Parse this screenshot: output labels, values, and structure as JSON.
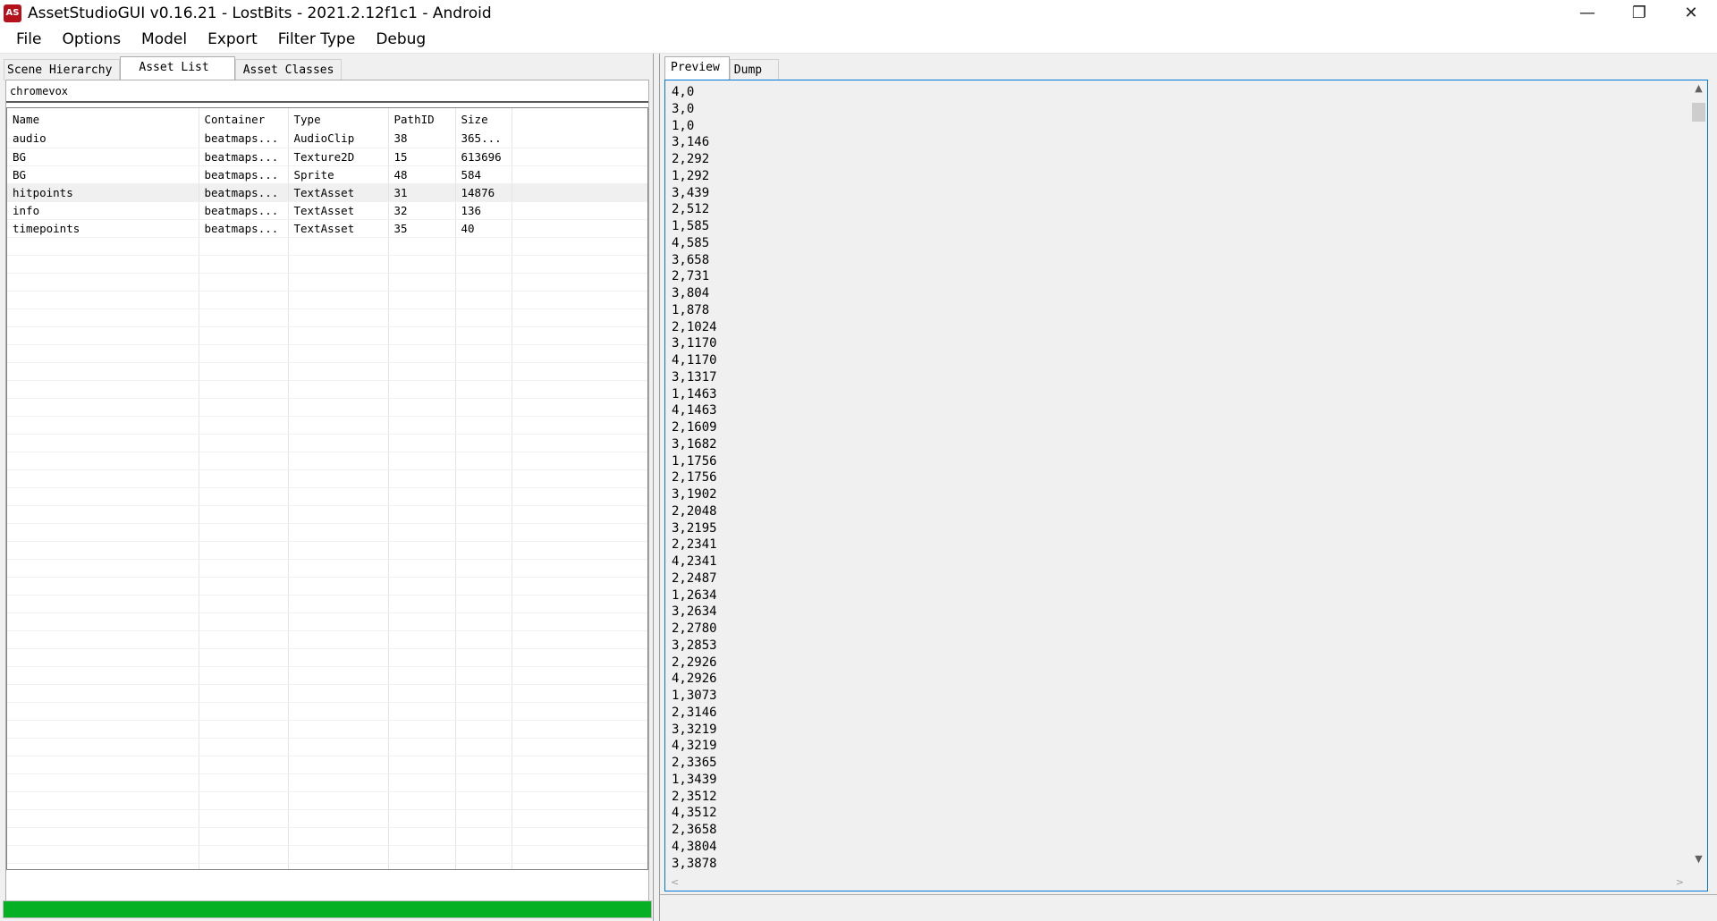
{
  "window": {
    "title": "AssetStudioGUI v0.16.21 - LostBits - 2021.2.12f1c1 - Android",
    "icon_label": "AS",
    "controls": {
      "minimize": "—",
      "restore": "❐",
      "close": "✕"
    }
  },
  "menu": [
    "File",
    "Options",
    "Model",
    "Export",
    "Filter Type",
    "Debug"
  ],
  "left_tabs": [
    "Scene Hierarchy",
    "Asset List",
    "Asset Classes"
  ],
  "active_left_tab": "Asset List",
  "filter_value": "chromevox",
  "asset_table": {
    "columns": [
      "Name",
      "Container",
      "Type",
      "PathID",
      "Size"
    ],
    "rows": [
      [
        "audio",
        "beatmaps...",
        "AudioClip",
        "38",
        "365..."
      ],
      [
        "BG",
        "beatmaps...",
        "Texture2D",
        "15",
        "613696"
      ],
      [
        "BG",
        "beatmaps...",
        "Sprite",
        "48",
        "584"
      ],
      [
        "hitpoints",
        "beatmaps...",
        "TextAsset",
        "31",
        "14876"
      ],
      [
        "info",
        "beatmaps...",
        "TextAsset",
        "32",
        "136"
      ],
      [
        "timepoints",
        "beatmaps...",
        "TextAsset",
        "35",
        "40"
      ]
    ],
    "selected_row": 3
  },
  "progress": {
    "value": 1.0,
    "color": "#06b025"
  },
  "right_tabs": [
    "Preview",
    "Dump"
  ],
  "active_right_tab": "Preview",
  "preview_lines": [
    "4,0",
    "3,0",
    "1,0",
    "3,146",
    "2,292",
    "1,292",
    "3,439",
    "2,512",
    "1,585",
    "4,585",
    "3,658",
    "2,731",
    "3,804",
    "1,878",
    "2,1024",
    "3,1170",
    "4,1170",
    "3,1317",
    "1,1463",
    "4,1463",
    "2,1609",
    "3,1682",
    "1,1756",
    "2,1756",
    "3,1902",
    "2,2048",
    "3,2195",
    "2,2341",
    "4,2341",
    "2,2487",
    "1,2634",
    "3,2634",
    "2,2780",
    "3,2853",
    "2,2926",
    "4,2926",
    "1,3073",
    "2,3146",
    "3,3219",
    "4,3219",
    "2,3365",
    "1,3439",
    "2,3512",
    "4,3512",
    "2,3658",
    "4,3804",
    "3,3878"
  ],
  "scroll_icons": {
    "up": "▲",
    "down": "▼",
    "left": "<",
    "right": ">"
  }
}
